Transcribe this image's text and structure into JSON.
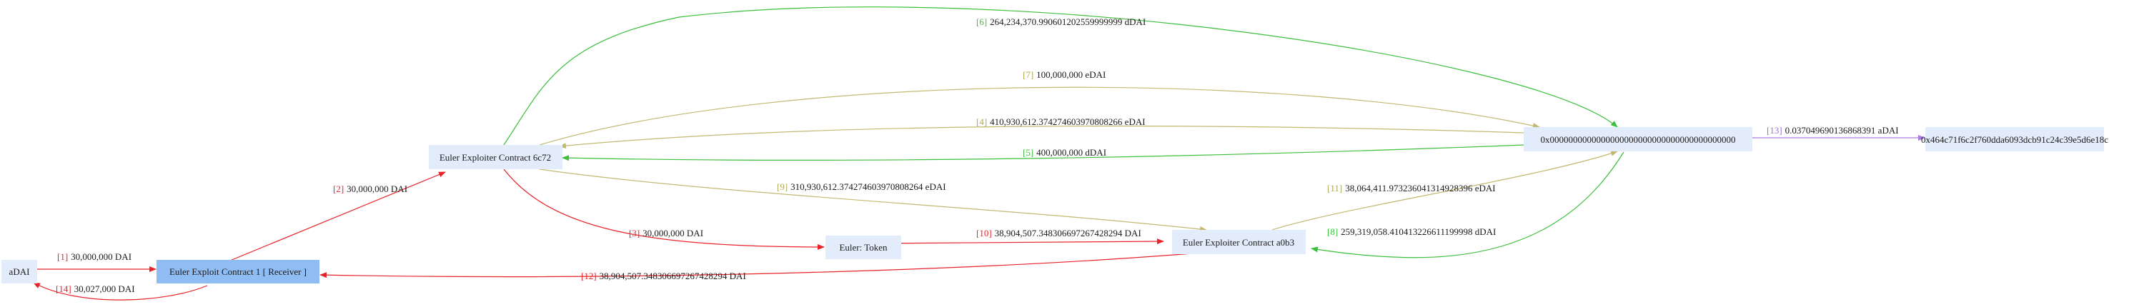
{
  "colors": {
    "node_fill": "#e3ecfb",
    "node_highlight_fill": "#8fbcf2",
    "red": "#e8232a",
    "green": "#3cbf3c",
    "olive": "#c2b870",
    "purple": "#a77be0",
    "olive_text": "#b0a85a",
    "purple_text": "#9a6fd6"
  },
  "nodes": {
    "adai": "aDAI",
    "receiver": "Euler Exploit Contract 1 [ Receiver ]",
    "c6c72": "Euler Exploiter Contract 6c72",
    "token": "Euler: Token",
    "a0b3": "Euler Exploiter Contract a0b3",
    "zero": "0x0000000000000000000000000000000000000000",
    "addr": "0x464c71f6c2f760dda6093dcb91c24c39e5d6e18c"
  },
  "edges": [
    {
      "id": 1,
      "num": "[1]",
      "text": "30,000,000 DAI",
      "color": "red"
    },
    {
      "id": 2,
      "num": "[2]",
      "text": "30,000,000 DAI",
      "color": "red"
    },
    {
      "id": 3,
      "num": "[3]",
      "text": "30,000,000 DAI",
      "color": "red"
    },
    {
      "id": 4,
      "num": "[4]",
      "text": "410,930,612.374274603970808266 eDAI",
      "color": "olive"
    },
    {
      "id": 5,
      "num": "[5]",
      "text": "400,000,000 dDAI",
      "color": "green"
    },
    {
      "id": 6,
      "num": "[6]",
      "text": "264,234,370.990601202559999999 dDAI",
      "color": "green"
    },
    {
      "id": 7,
      "num": "[7]",
      "text": "100,000,000 eDAI",
      "color": "olive"
    },
    {
      "id": 8,
      "num": "[8]",
      "text": "259,319,058.410413226611199998 dDAI",
      "color": "green"
    },
    {
      "id": 9,
      "num": "[9]",
      "text": "310,930,612.374274603970808264 eDAI",
      "color": "olive"
    },
    {
      "id": 10,
      "num": "[10]",
      "text": "38,904,507.348306697267428294 DAI",
      "color": "red"
    },
    {
      "id": 11,
      "num": "[11]",
      "text": "38,064,411.973236041314928396 eDAI",
      "color": "olive"
    },
    {
      "id": 12,
      "num": "[12]",
      "text": "38,904,507.348306697267428294 DAI",
      "color": "red"
    },
    {
      "id": 13,
      "num": "[13]",
      "text": "0.037049690136868391 aDAI",
      "color": "purple"
    },
    {
      "id": 14,
      "num": "[14]",
      "text": "30,027,000 DAI",
      "color": "red"
    }
  ]
}
